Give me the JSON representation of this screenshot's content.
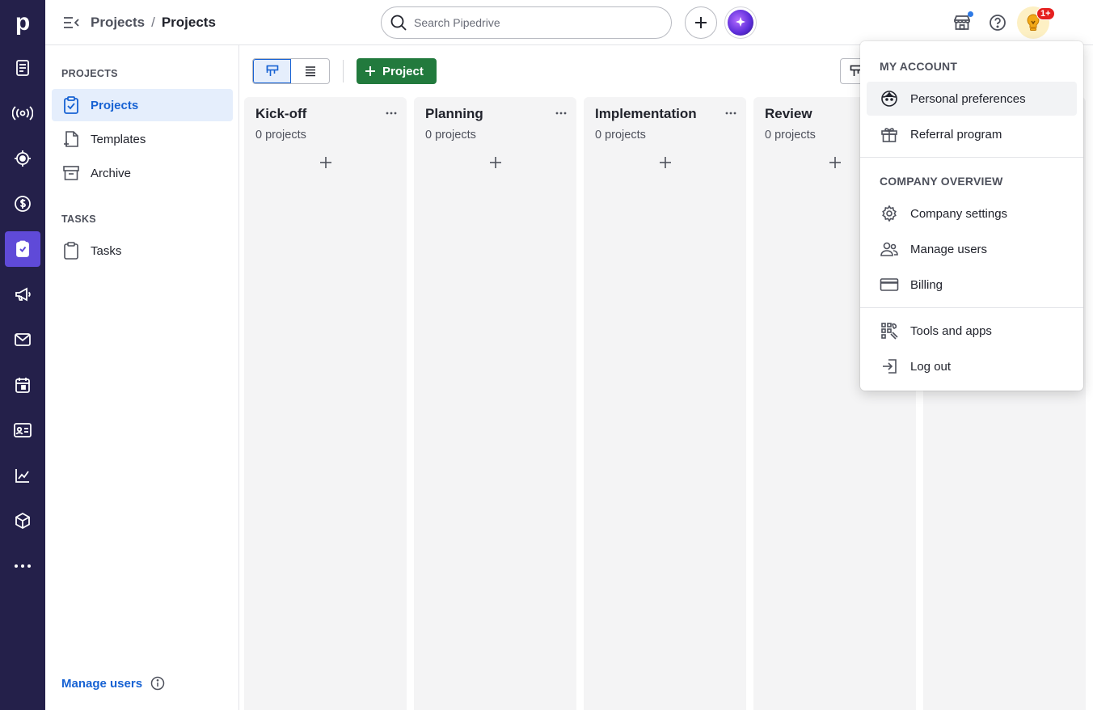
{
  "brand": {
    "logo_letter": "p",
    "rail_color": "#24204a",
    "accent": "#5f4ad8",
    "link_color": "#1762d3",
    "primary_button_color": "#227a3d"
  },
  "rail": {
    "items": [
      {
        "name": "leads-icon"
      },
      {
        "name": "broadcast-icon"
      },
      {
        "name": "target-icon"
      },
      {
        "name": "dollar-icon"
      },
      {
        "name": "projects-icon",
        "active": true
      },
      {
        "name": "megaphone-icon"
      },
      {
        "name": "mail-icon"
      },
      {
        "name": "calendar-icon"
      },
      {
        "name": "contacts-card-icon"
      },
      {
        "name": "chart-icon"
      },
      {
        "name": "box-icon"
      },
      {
        "name": "more-icon"
      }
    ]
  },
  "topbar": {
    "breadcrumb": [
      "Projects",
      "Projects"
    ],
    "breadcrumb_separator": "/",
    "search_placeholder": "Search Pipedrive",
    "notification_badge": "1+"
  },
  "sidebar": {
    "section1": "PROJECTS",
    "items1": [
      {
        "label": "Projects",
        "icon": "clipboard-check-icon",
        "active": true
      },
      {
        "label": "Templates",
        "icon": "template-icon"
      },
      {
        "label": "Archive",
        "icon": "archive-icon"
      }
    ],
    "section2": "TASKS",
    "items2": [
      {
        "label": "Tasks",
        "icon": "clipboard-icon"
      }
    ],
    "footer_link": "Manage users"
  },
  "toolbar": {
    "add_project_label": "Project"
  },
  "board": {
    "columns": [
      {
        "title": "Kick-off",
        "count": "0 projects"
      },
      {
        "title": "Planning",
        "count": "0 projects"
      },
      {
        "title": "Implementation",
        "count": "0 projects"
      },
      {
        "title": "Review",
        "count": "0 projects"
      },
      {
        "title": "",
        "count": ""
      }
    ]
  },
  "account_menu": {
    "section1": "MY ACCOUNT",
    "items1": [
      {
        "label": "Personal preferences",
        "icon": "face-icon",
        "hover": true
      },
      {
        "label": "Referral program",
        "icon": "gift-icon"
      }
    ],
    "section2": "COMPANY OVERVIEW",
    "items2": [
      {
        "label": "Company settings",
        "icon": "gear-icon"
      },
      {
        "label": "Manage users",
        "icon": "users-icon"
      },
      {
        "label": "Billing",
        "icon": "credit-card-icon"
      }
    ],
    "items3": [
      {
        "label": "Tools and apps",
        "icon": "tools-icon"
      },
      {
        "label": "Log out",
        "icon": "logout-icon"
      }
    ]
  }
}
